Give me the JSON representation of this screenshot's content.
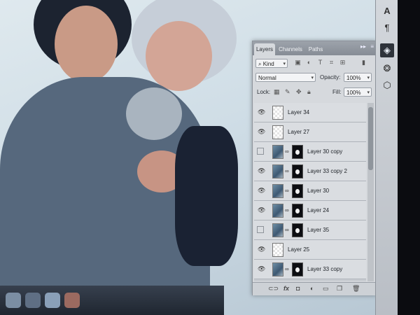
{
  "panel": {
    "tabs": [
      "Layers",
      "Channels",
      "Paths"
    ],
    "tab_menu": "▸▸",
    "tab_close": "≡",
    "filter_kind": "Kind",
    "blend_mode": "Normal",
    "opacity_label": "Opacity:",
    "opacity_value": "100%",
    "lock_label": "Lock:",
    "fill_label": "Fill:",
    "fill_value": "100%",
    "layers": [
      {
        "name": "Layer 34",
        "visible": true,
        "mask": false
      },
      {
        "name": "Layer 27",
        "visible": true,
        "mask": false
      },
      {
        "name": "Layer 30 copy",
        "visible": false,
        "mask": true
      },
      {
        "name": "Layer 33 copy 2",
        "visible": true,
        "mask": true
      },
      {
        "name": "Layer 30",
        "visible": true,
        "mask": true
      },
      {
        "name": "Layer 24",
        "visible": true,
        "mask": true
      },
      {
        "name": "Layer 35",
        "visible": false,
        "mask": true
      },
      {
        "name": "Layer 25",
        "visible": true,
        "mask": false
      },
      {
        "name": "Layer 33 copy",
        "visible": true,
        "mask": true
      }
    ],
    "footer_icons": [
      "link-icon",
      "fx-icon",
      "add-mask-icon",
      "adjustment-icon",
      "group-icon",
      "new-layer-icon",
      "trash-icon"
    ]
  },
  "toolstrip": {
    "tools": [
      "character-tool-icon",
      "paragraph-tool-icon",
      "layers-tool-icon",
      "channels-tool-icon",
      "paths-tool-icon"
    ]
  }
}
